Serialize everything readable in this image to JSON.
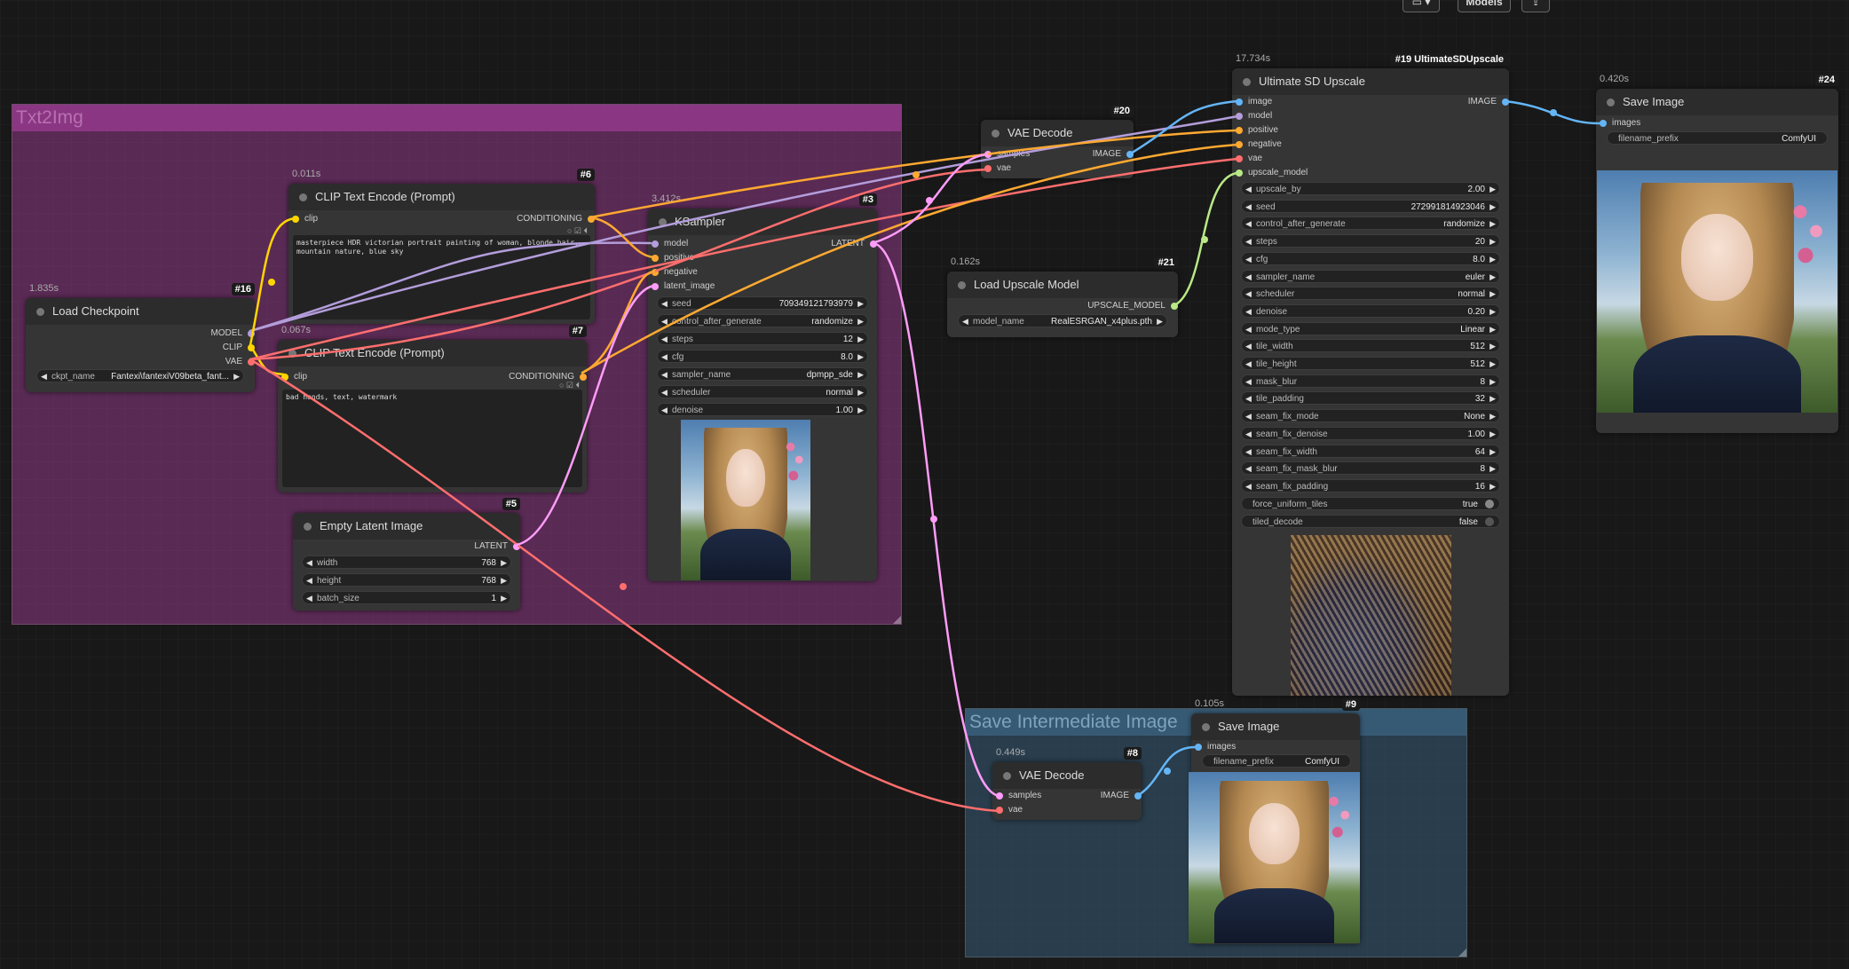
{
  "toolbar": {
    "models_label": "Models"
  },
  "groups": {
    "txt2img": "Txt2Img",
    "save_intermediate": "Save Intermediate Image"
  },
  "nodes": {
    "load_checkpoint": {
      "time": "1.835s",
      "id": "#16",
      "title": "Load Checkpoint",
      "outputs": [
        "MODEL",
        "CLIP",
        "VAE"
      ],
      "widgets": [
        {
          "label": "ckpt_name",
          "value": "Fantexi\\fantexiV09beta_fant..."
        }
      ]
    },
    "clip_pos": {
      "time": "0.011s",
      "id": "#6",
      "title": "CLIP Text Encode (Prompt)",
      "input": "clip",
      "output": "CONDITIONING",
      "text": "masterpiece HDR victorian portrait painting of woman, blonde hair, mountain nature, blue sky"
    },
    "clip_neg": {
      "time": "0.067s",
      "id": "#7",
      "title": "CLIP Text Encode (Prompt)",
      "input": "clip",
      "output": "CONDITIONING",
      "text": "bad hands, text, watermark"
    },
    "empty_latent": {
      "id": "#5",
      "title": "Empty Latent Image",
      "output": "LATENT",
      "widgets": [
        {
          "label": "width",
          "value": "768"
        },
        {
          "label": "height",
          "value": "768"
        },
        {
          "label": "batch_size",
          "value": "1"
        }
      ]
    },
    "ksampler": {
      "time": "3.412s",
      "id": "#3",
      "title": "KSampler",
      "inputs": [
        "model",
        "positive",
        "negative",
        "latent_image"
      ],
      "output": "LATENT",
      "widgets": [
        {
          "label": "seed",
          "value": "709349121793979"
        },
        {
          "label": "control_after_generate",
          "value": "randomize"
        },
        {
          "label": "steps",
          "value": "12"
        },
        {
          "label": "cfg",
          "value": "8.0"
        },
        {
          "label": "sampler_name",
          "value": "dpmpp_sde"
        },
        {
          "label": "scheduler",
          "value": "normal"
        },
        {
          "label": "denoise",
          "value": "1.00"
        }
      ]
    },
    "vae_decode_20": {
      "id": "#20",
      "title": "VAE Decode",
      "inputs": [
        "samples",
        "vae"
      ],
      "output": "IMAGE"
    },
    "load_upscale": {
      "time": "0.162s",
      "id": "#21",
      "title": "Load Upscale Model",
      "output": "UPSCALE_MODEL",
      "widgets": [
        {
          "label": "model_name",
          "value": "RealESRGAN_x4plus.pth"
        }
      ]
    },
    "ultimate": {
      "time": "17.734s",
      "id": "#19 UltimateSDUpscale",
      "title": "Ultimate SD Upscale",
      "inputs": [
        "image",
        "model",
        "positive",
        "negative",
        "vae",
        "upscale_model"
      ],
      "output": "IMAGE",
      "widgets": [
        {
          "label": "upscale_by",
          "value": "2.00"
        },
        {
          "label": "seed",
          "value": "272991814923046"
        },
        {
          "label": "control_after_generate",
          "value": "randomize"
        },
        {
          "label": "steps",
          "value": "20"
        },
        {
          "label": "cfg",
          "value": "8.0"
        },
        {
          "label": "sampler_name",
          "value": "euler"
        },
        {
          "label": "scheduler",
          "value": "normal"
        },
        {
          "label": "denoise",
          "value": "0.20"
        },
        {
          "label": "mode_type",
          "value": "Linear"
        },
        {
          "label": "tile_width",
          "value": "512"
        },
        {
          "label": "tile_height",
          "value": "512"
        },
        {
          "label": "mask_blur",
          "value": "8"
        },
        {
          "label": "tile_padding",
          "value": "32"
        },
        {
          "label": "seam_fix_mode",
          "value": "None"
        },
        {
          "label": "seam_fix_denoise",
          "value": "1.00"
        },
        {
          "label": "seam_fix_width",
          "value": "64"
        },
        {
          "label": "seam_fix_mask_blur",
          "value": "8"
        },
        {
          "label": "seam_fix_padding",
          "value": "16"
        }
      ],
      "toggles": [
        {
          "label": "force_uniform_tiles",
          "value": "true"
        },
        {
          "label": "tiled_decode",
          "value": "false"
        }
      ]
    },
    "save_24": {
      "time": "0.420s",
      "id": "#24",
      "title": "Save Image",
      "input": "images",
      "widget": {
        "label": "filename_prefix",
        "value": "ComfyUI"
      }
    },
    "save_9": {
      "time": "0.105s",
      "id": "#9",
      "title": "Save Image",
      "input": "images",
      "widget": {
        "label": "filename_prefix",
        "value": "ComfyUI"
      }
    },
    "vae_decode_8": {
      "time": "0.449s",
      "id": "#8",
      "title": "VAE Decode",
      "inputs": [
        "samples",
        "vae"
      ],
      "output": "IMAGE"
    }
  },
  "colors": {
    "model": "#b39ddb",
    "clip": "#ffd500",
    "vae": "#ff6e6e",
    "conditioning": "#ffa931",
    "latent": "#ff9cf9",
    "image": "#64b5f6",
    "upscale_model": "#b8e986"
  }
}
